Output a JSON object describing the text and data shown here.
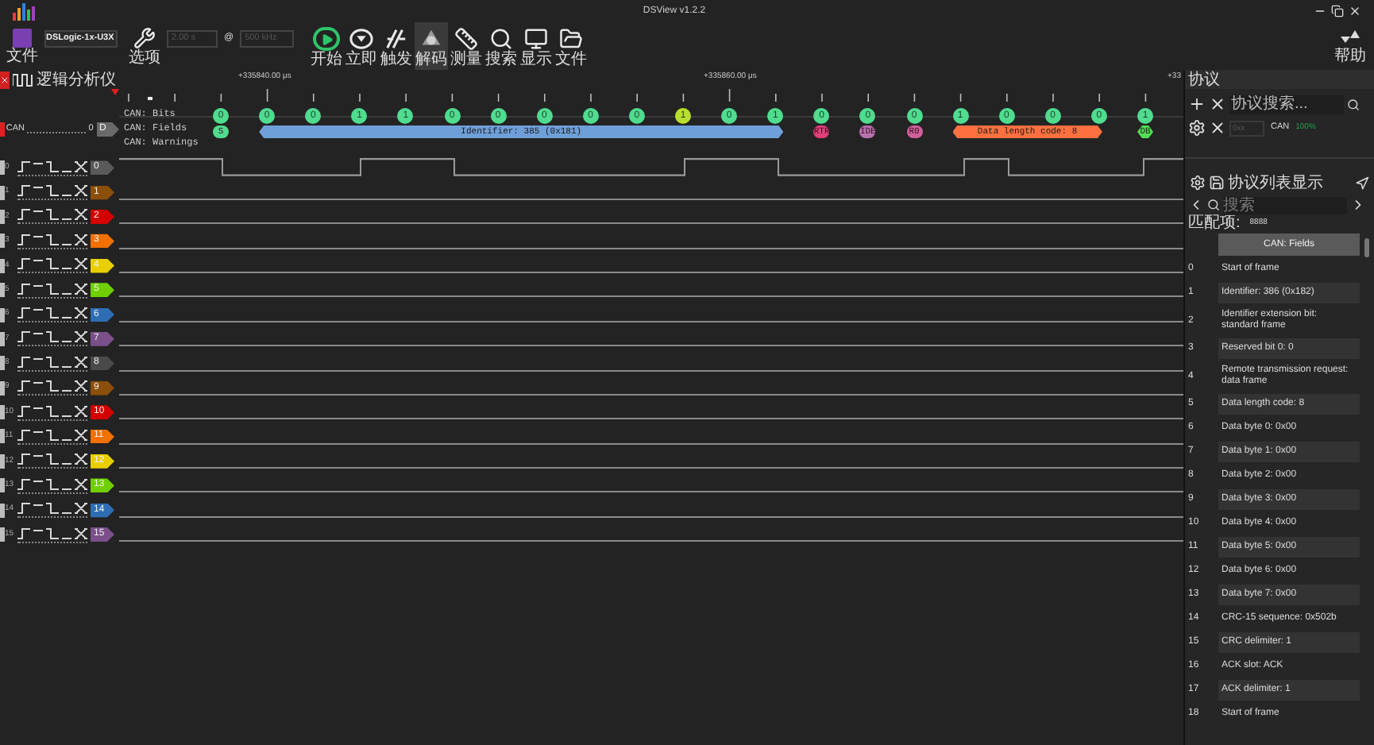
{
  "window": {
    "title": "DSView v1.2.2"
  },
  "toolbar": {
    "file": {
      "label": "文件"
    },
    "device": {
      "value": "DSLogic-1x-U3X"
    },
    "options": {
      "label": "选项"
    },
    "duration": {
      "value": "2.00 s",
      "disabled": true
    },
    "at": "@",
    "rate": {
      "value": "500 kHz",
      "disabled": true
    },
    "actions": [
      {
        "label": "开始",
        "selected": false
      },
      {
        "label": "立即",
        "selected": false
      },
      {
        "label": "触发",
        "selected": false
      },
      {
        "label": "解码",
        "selected": true
      },
      {
        "label": "测量",
        "selected": false
      },
      {
        "label": "搜索",
        "selected": false
      },
      {
        "label": "显示",
        "selected": false
      },
      {
        "label": "文件",
        "selected": false
      }
    ],
    "help": {
      "label": "帮助"
    }
  },
  "session": {
    "label": "逻辑分析仪"
  },
  "ruler": {
    "labels": [
      "+335840.00 μs",
      "+335860.00 μs",
      "+33"
    ]
  },
  "decoder": {
    "name": "CAN",
    "value": "0",
    "tag": "D",
    "rows": [
      "CAN: Bits",
      "CAN: Fields",
      "CAN: Warnings"
    ],
    "bits": [
      {
        "value": "0",
        "kind": "data"
      },
      {
        "value": "0",
        "kind": "data"
      },
      {
        "value": "0",
        "kind": "data"
      },
      {
        "value": "1",
        "kind": "data"
      },
      {
        "value": "1",
        "kind": "data"
      },
      {
        "value": "0",
        "kind": "data"
      },
      {
        "value": "0",
        "kind": "data"
      },
      {
        "value": "0",
        "kind": "data"
      },
      {
        "value": "0",
        "kind": "data"
      },
      {
        "value": "0",
        "kind": "data"
      },
      {
        "value": "1",
        "kind": "stuff"
      },
      {
        "value": "0",
        "kind": "data"
      },
      {
        "value": "1",
        "kind": "data"
      },
      {
        "value": "0",
        "kind": "data"
      },
      {
        "value": "0",
        "kind": "data"
      },
      {
        "value": "0",
        "kind": "data"
      },
      {
        "value": "1",
        "kind": "data"
      },
      {
        "value": "0",
        "kind": "data"
      },
      {
        "value": "0",
        "kind": "data"
      },
      {
        "value": "0",
        "kind": "data"
      },
      {
        "value": "1",
        "kind": "data"
      }
    ],
    "fields": [
      {
        "text": "S",
        "kind": "bit",
        "color": "#4fdc8f"
      },
      {
        "text": "Identifier: 385 (0x181)",
        "kind": "bar",
        "color": "#6f9fd8"
      },
      {
        "text": "RTR",
        "kind": "bit",
        "color": "#e0407a"
      },
      {
        "text": "IDE",
        "kind": "bit",
        "color": "#b872b0"
      },
      {
        "text": "R0",
        "kind": "bit",
        "color": "#d0609c"
      },
      {
        "text": "Data length code: 8",
        "kind": "bar",
        "color": "#ff7040"
      },
      {
        "text": "DB",
        "kind": "bar",
        "color": "#52e052"
      }
    ]
  },
  "channels": [
    {
      "number": "0",
      "tag": "0",
      "color": "#5a5a5a"
    },
    {
      "number": "1",
      "tag": "1",
      "color": "#8b4f0a"
    },
    {
      "number": "2",
      "tag": "2",
      "color": "#d40000"
    },
    {
      "number": "3",
      "tag": "3",
      "color": "#f07000"
    },
    {
      "number": "4",
      "tag": "4",
      "color": "#e8d000"
    },
    {
      "number": "5",
      "tag": "5",
      "color": "#6fcf00"
    },
    {
      "number": "6",
      "tag": "6",
      "color": "#2e6db4"
    },
    {
      "number": "7",
      "tag": "7",
      "color": "#7a4f8a"
    },
    {
      "number": "8",
      "tag": "8",
      "color": "#4a4a4a"
    },
    {
      "number": "9",
      "tag": "9",
      "color": "#8b4f0a"
    },
    {
      "number": "10",
      "tag": "10",
      "color": "#d40000"
    },
    {
      "number": "11",
      "tag": "11",
      "color": "#f07000"
    },
    {
      "number": "12",
      "tag": "12",
      "color": "#e8d000"
    },
    {
      "number": "13",
      "tag": "13",
      "color": "#6fcf00"
    },
    {
      "number": "14",
      "tag": "14",
      "color": "#2e6db4"
    },
    {
      "number": "15",
      "tag": "15",
      "color": "#7a4f8a"
    }
  ],
  "protocol_panel": {
    "title": "协议",
    "search": {
      "placeholder": "协议搜索..."
    },
    "decoder": {
      "select": "0xx",
      "name": "CAN",
      "progress": "100%",
      "complete": true
    }
  },
  "list_panel": {
    "title": "协议列表显示",
    "search": {
      "placeholder": "搜索"
    },
    "match_label": "匹配项:",
    "match_count": "8888",
    "column": "CAN: Fields",
    "rows": [
      {
        "index": "0",
        "text": "Start of frame"
      },
      {
        "index": "1",
        "text": "Identifier: 386 (0x182)"
      },
      {
        "index": "2",
        "text": "Identifier extension bit: standard frame"
      },
      {
        "index": "3",
        "text": "Reserved bit 0: 0"
      },
      {
        "index": "4",
        "text": "Remote transmission request: data frame"
      },
      {
        "index": "5",
        "text": "Data length code: 8"
      },
      {
        "index": "6",
        "text": "Data byte 0: 0x00"
      },
      {
        "index": "7",
        "text": "Data byte 1: 0x00"
      },
      {
        "index": "8",
        "text": "Data byte 2: 0x00"
      },
      {
        "index": "9",
        "text": "Data byte 3: 0x00"
      },
      {
        "index": "10",
        "text": "Data byte 4: 0x00"
      },
      {
        "index": "11",
        "text": "Data byte 5: 0x00"
      },
      {
        "index": "12",
        "text": "Data byte 6: 0x00"
      },
      {
        "index": "13",
        "text": "Data byte 7: 0x00"
      },
      {
        "index": "14",
        "text": "CRC-15 sequence: 0x502b"
      },
      {
        "index": "15",
        "text": "CRC delimiter: 1"
      },
      {
        "index": "16",
        "text": "ACK slot: ACK"
      },
      {
        "index": "17",
        "text": "ACK delimiter: 1"
      },
      {
        "index": "18",
        "text": "Start of frame"
      }
    ]
  }
}
